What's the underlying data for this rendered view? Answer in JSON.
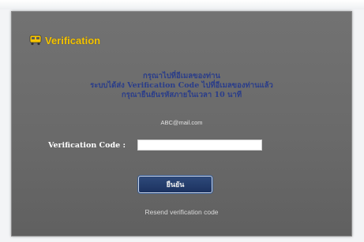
{
  "header": {
    "title": "Verification",
    "icon": "bus-icon"
  },
  "message": {
    "line1": "กรุณาไปที่อีเมลของท่าน",
    "line2": "ระบบได้ส่ง Verification Code ไปที่อีเมลของท่านแล้ว",
    "line3": "กรุณายืนยันรหัสภายในเวลา 10 นาที"
  },
  "email": "ABC@mail.com",
  "form": {
    "code_label": "Verification Code :",
    "code_value": "",
    "confirm_label": "ยืนยัน"
  },
  "links": {
    "resend": "Resend verification code"
  },
  "colors": {
    "title": "#f6c400",
    "message_text": "#2a3d8a",
    "panel_bg": "#6a6a6a",
    "button_bg": "#1c3260"
  }
}
